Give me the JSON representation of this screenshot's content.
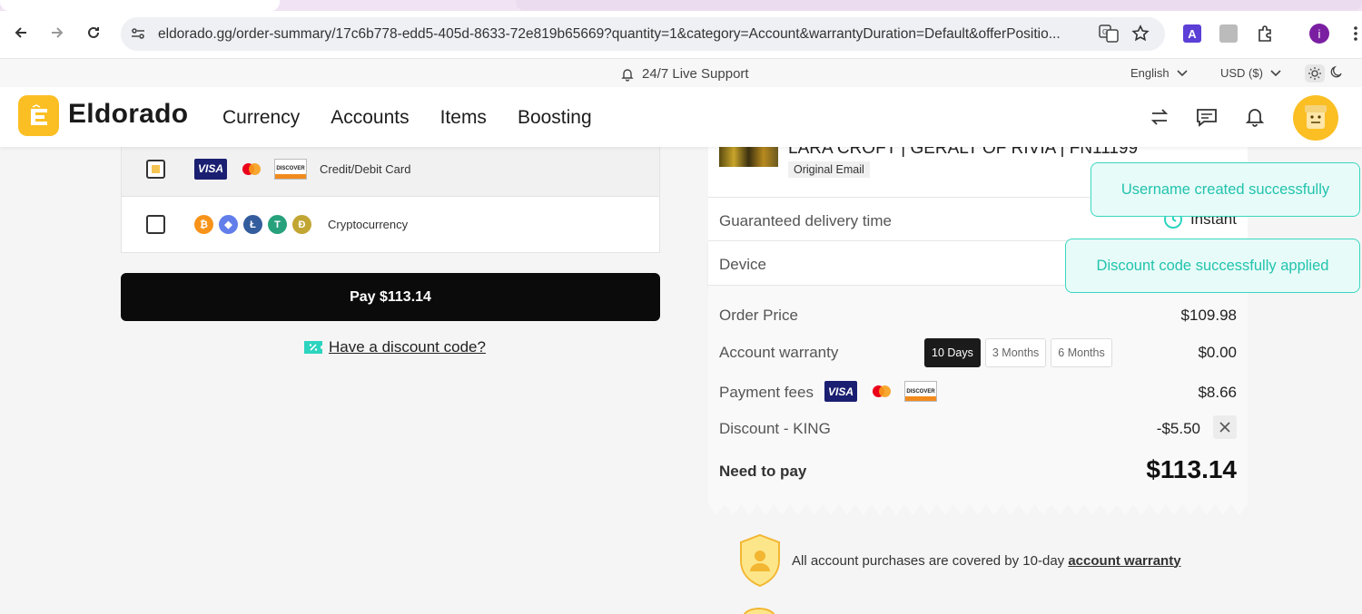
{
  "browser": {
    "url": "eldorado.gg/order-summary/17c6b778-edd5-405d-8633-72e819b65669?quantity=1&category=Account&warrantyDuration=Default&offerPositio...",
    "profile_initial": "i"
  },
  "supportbar": {
    "support": "24/7 Live Support",
    "language": "English",
    "currency": "USD ($)"
  },
  "header": {
    "logo": "Eldorado",
    "nav": [
      "Currency",
      "Accounts",
      "Items",
      "Boosting"
    ]
  },
  "payment": {
    "methods": [
      {
        "label": "Credit/Debit Card",
        "selected": true
      },
      {
        "label": "Cryptocurrency",
        "selected": false
      }
    ],
    "card_visa": "VISA",
    "card_discover": "DISCOVER",
    "pay_button": "Pay $113.14",
    "discount_link": "Have a discount code?"
  },
  "summary": {
    "product_title": "LARA CROFT | GERALT OF RIVIA | FN11199",
    "product_tag": "Original Email",
    "delivery_label": "Guaranteed delivery time",
    "delivery_value": "Instant",
    "device_label": "Device",
    "order_price_label": "Order Price",
    "order_price": "$109.98",
    "warranty_label": "Account warranty",
    "warranty_options": [
      "10 Days",
      "3 Months",
      "6 Months"
    ],
    "warranty_selected": "10 Days",
    "warranty_price": "$0.00",
    "fees_label": "Payment fees",
    "fees": "$8.66",
    "discount_label": "Discount - KING",
    "discount": "-$5.50",
    "need_label": "Need to pay",
    "total": "$113.14"
  },
  "toasts": {
    "username": "Username created successfully",
    "discount": "Discount code successfully applied"
  },
  "warranty_note": {
    "text": "All account purchases are covered by 10-day",
    "link": "account warranty"
  },
  "colors": {
    "brand": "#fbbf24",
    "toast": "#22c3ad",
    "button": "#0b0b0b"
  }
}
